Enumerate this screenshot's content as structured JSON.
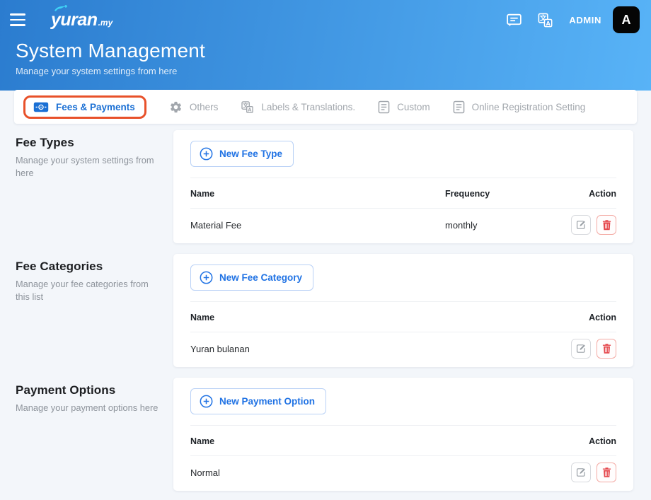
{
  "header": {
    "logo_text": "yuran",
    "logo_suffix": ".my",
    "admin_label": "ADMIN",
    "avatar_letter": "A",
    "title": "System Management",
    "subtitle": "Manage your system settings from here"
  },
  "tabs": [
    {
      "label": "Fees & Payments",
      "icon": "banknote-icon",
      "active": true,
      "highlighted": true
    },
    {
      "label": "Others",
      "icon": "gear-icon",
      "active": false
    },
    {
      "label": "Labels & Translations.",
      "icon": "translate-icon",
      "active": false
    },
    {
      "label": "Custom",
      "icon": "document-icon",
      "active": false
    },
    {
      "label": "Online Registration Setting",
      "icon": "document-icon",
      "active": false
    }
  ],
  "sections": [
    {
      "title": "Fee Types",
      "description": "Manage your system settings from here",
      "button_label": "New Fee Type",
      "columns": [
        "Name",
        "Frequency",
        "Action"
      ],
      "rows": [
        {
          "name": "Material Fee",
          "frequency": "monthly"
        }
      ]
    },
    {
      "title": "Fee Categories",
      "description": "Manage your fee categories from this list",
      "button_label": "New Fee Category",
      "columns": [
        "Name",
        "Action"
      ],
      "rows": [
        {
          "name": "Yuran bulanan"
        }
      ]
    },
    {
      "title": "Payment Options",
      "description": "Manage your payment options here",
      "button_label": "New Payment Option",
      "columns": [
        "Name",
        "Action"
      ],
      "rows": [
        {
          "name": "Normal"
        }
      ]
    }
  ],
  "colors": {
    "header_gradient_start": "#2b7ccf",
    "header_gradient_end": "#58b3f7",
    "accent_blue": "#1a6fd4",
    "highlight_orange": "#e8512a",
    "inactive_gray": "#a2a7ad",
    "delete_red": "#e5484d",
    "page_background": "#f3f6fa"
  }
}
